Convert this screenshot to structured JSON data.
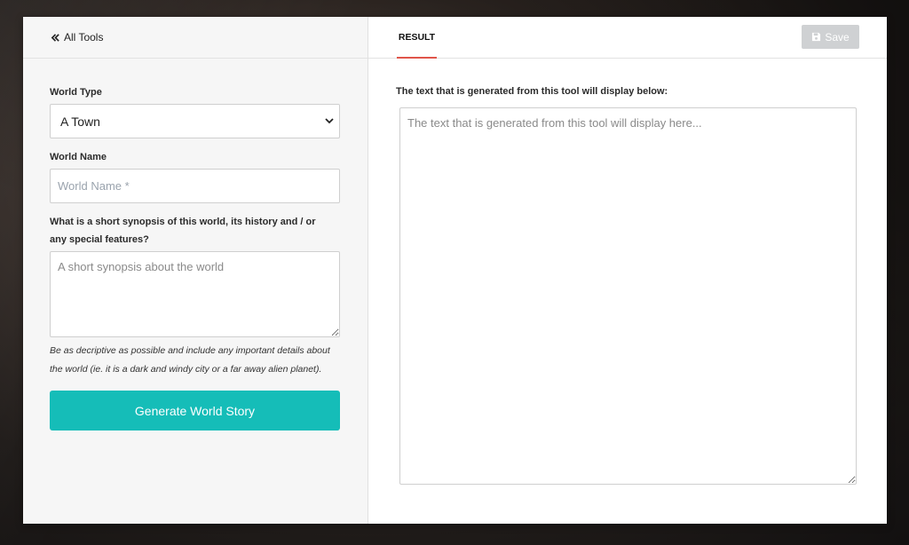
{
  "left": {
    "back_label": "All Tools",
    "world_type": {
      "label": "World Type",
      "selected": "A Town"
    },
    "world_name": {
      "label": "World Name",
      "placeholder": "World Name *"
    },
    "synopsis": {
      "label": "What is a short synopsis of this world, its history and / or any special features?",
      "placeholder": "A short synopsis about the world",
      "hint": "Be as decriptive as possible and include any important details about the world (ie. it is a dark and windy city or a far away alien planet)."
    },
    "generate_label": "Generate World Story"
  },
  "right": {
    "tab_label": "RESULT",
    "save_label": "Save",
    "output_label": "The text that is generated from this tool will display below:",
    "output_placeholder": "The text that is generated from this tool will display here..."
  },
  "colors": {
    "accent": "#15bdb8",
    "tab_underline": "#e0554a",
    "save_disabled": "#cfd1d3"
  },
  "icons": {
    "back": "double-chevron-left-icon",
    "save": "floppy-disk-icon",
    "select": "chevron-down-icon"
  }
}
